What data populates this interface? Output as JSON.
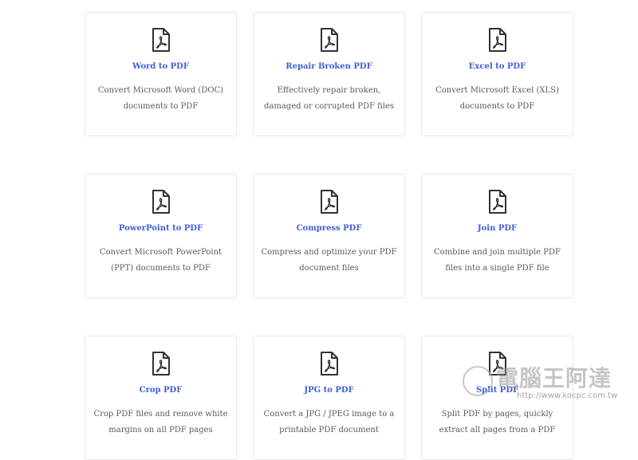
{
  "tools": [
    {
      "title": "Word to PDF",
      "description": "Convert Microsoft Word (DOC) documents to PDF",
      "icon": "pdf-file-icon"
    },
    {
      "title": "Repair Broken PDF",
      "description": "Effectively repair broken, damaged or corrupted PDF files",
      "icon": "pdf-file-icon"
    },
    {
      "title": "Excel to PDF",
      "description": "Convert Microsoft Excel (XLS) documents to PDF",
      "icon": "pdf-file-icon"
    },
    {
      "title": "PowerPoint to PDF",
      "description": "Convert Microsoft PowerPoint (PPT) documents to PDF",
      "icon": "pdf-file-icon"
    },
    {
      "title": "Compress PDF",
      "description": "Compress and optimize your PDF document files",
      "icon": "pdf-file-icon"
    },
    {
      "title": "Join PDF",
      "description": "Combine and join multiple PDF files into a single PDF file",
      "icon": "pdf-file-icon"
    },
    {
      "title": "Crop PDF",
      "description": "Crop PDF files and remove white margins on all PDF pages",
      "icon": "pdf-file-icon"
    },
    {
      "title": "JPG to PDF",
      "description": "Convert a JPG / JPEG image to a printable PDF document",
      "icon": "pdf-file-icon"
    },
    {
      "title": "Split PDF",
      "description": "Split PDF by pages, quickly extract all pages from a PDF",
      "icon": "pdf-file-icon"
    }
  ],
  "watermark": {
    "text": "電腦王阿達",
    "url": "http://www.kocpc.com.tw"
  },
  "colors": {
    "title": "#3f5fd6",
    "description": "#555a60",
    "icon": "#2d3338",
    "card_border": "#e8e8ee"
  }
}
